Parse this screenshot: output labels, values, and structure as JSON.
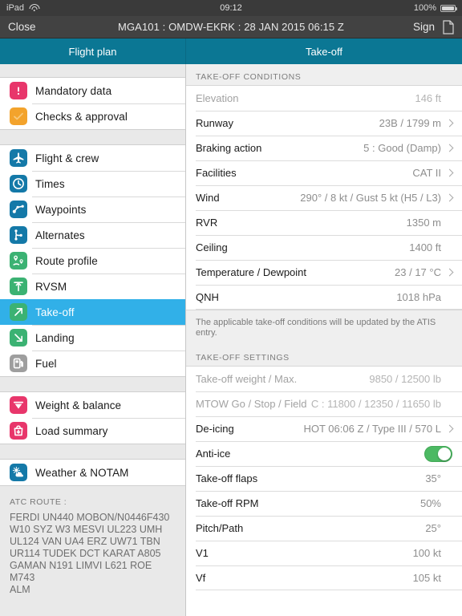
{
  "statusbar": {
    "device": "iPad",
    "wifi_icon": "wifi-icon",
    "time": "09:12",
    "battery_pct": "100%",
    "battery_icon": "battery-icon"
  },
  "navbar": {
    "close_label": "Close",
    "title": "MGA101 : OMDW-EKRK : 28 JAN 2015 06:15 Z",
    "sign_label": "Sign",
    "document_icon": "document-icon"
  },
  "tabs": {
    "left_label": "Flight plan",
    "right_label": "Take-off",
    "accent_color": "#0b7794"
  },
  "sidebar": {
    "groups": [
      {
        "items": [
          {
            "label": "Mandatory data",
            "icon": "exclamation-icon",
            "color": "#e8366b",
            "active": false
          },
          {
            "label": "Checks & approval",
            "icon": "checkmark-icon",
            "color": "#f3a32c",
            "active": false
          }
        ]
      },
      {
        "items": [
          {
            "label": "Flight & crew",
            "icon": "airplane-icon",
            "color": "#1479a8",
            "active": false
          },
          {
            "label": "Times",
            "icon": "clock-icon",
            "color": "#1479a8",
            "active": false
          },
          {
            "label": "Waypoints",
            "icon": "waypoints-icon",
            "color": "#1479a8",
            "active": false
          },
          {
            "label": "Alternates",
            "icon": "branch-icon",
            "color": "#1479a8",
            "active": false
          },
          {
            "label": "Route profile",
            "icon": "route-pins-icon",
            "color": "#3bb273",
            "active": false
          },
          {
            "label": "RVSM",
            "icon": "altitude-icon",
            "color": "#3bb273",
            "active": false
          },
          {
            "label": "Take-off",
            "icon": "arrow-up-right-icon",
            "color": "#3bb273",
            "active": true
          },
          {
            "label": "Landing",
            "icon": "arrow-down-right-icon",
            "color": "#3bb273",
            "active": false
          },
          {
            "label": "Fuel",
            "icon": "fuel-pump-icon",
            "color": "#9e9e9e",
            "active": false
          }
        ]
      },
      {
        "items": [
          {
            "label": "Weight & balance",
            "icon": "scale-icon",
            "color": "#e8366b",
            "active": false
          },
          {
            "label": "Load summary",
            "icon": "load-bag-icon",
            "color": "#e8366b",
            "active": false
          }
        ]
      },
      {
        "items": [
          {
            "label": "Weather & NOTAM",
            "icon": "weather-icon",
            "color": "#1479a8",
            "active": false
          }
        ]
      }
    ],
    "atc": {
      "heading": "ATC ROUTE :",
      "body": "FERDI UN440 MOBON/N0446F430\nW10 SYZ W3 MESVI UL223 UMH\nUL124 VAN UA4 ERZ UW71 TBN\nUR114 TUDEK DCT KARAT A805\nGAMAN N191 LIMVI L621 ROE M743\nALM"
    },
    "active_color": "#31b0e8"
  },
  "detail": {
    "conditions_header": "TAKE-OFF CONDITIONS",
    "conditions": [
      {
        "label": "Elevation",
        "value": "146 ft",
        "chevron": false,
        "dim": true
      },
      {
        "label": "Runway",
        "value": "23B / 1799 m",
        "chevron": true,
        "dim": false
      },
      {
        "label": "Braking action",
        "value": "5 : Good (Damp)",
        "chevron": true,
        "dim": false
      },
      {
        "label": "Facilities",
        "value": "CAT II",
        "chevron": true,
        "dim": false
      },
      {
        "label": "Wind",
        "value": "290° / 8 kt / Gust 5 kt (H5 / L3)",
        "chevron": true,
        "dim": false
      },
      {
        "label": "RVR",
        "value": "1350 m",
        "chevron": false,
        "dim": false
      },
      {
        "label": "Ceiling",
        "value": "1400 ft",
        "chevron": false,
        "dim": false
      },
      {
        "label": "Temperature / Dewpoint",
        "value": "23 / 17 °C",
        "chevron": true,
        "dim": false
      },
      {
        "label": "QNH",
        "value": "1018 hPa",
        "chevron": false,
        "dim": false
      }
    ],
    "note": "The applicable take-off conditions will be updated by the ATIS entry.",
    "settings_header": "TAKE-OFF SETTINGS",
    "settings": [
      {
        "label": "Take-off weight / Max.",
        "value": "9850 / 12500 lb",
        "chevron": false,
        "dim": true,
        "toggle": null
      },
      {
        "label": "MTOW Go / Stop / Field",
        "value": "C : 11800 / 12350 / 11650 lb",
        "chevron": false,
        "dim": true,
        "toggle": null
      },
      {
        "label": "De-icing",
        "value": "HOT 06:06 Z / Type III / 570 L",
        "chevron": true,
        "dim": false,
        "toggle": null
      },
      {
        "label": "Anti-ice",
        "value": "",
        "chevron": false,
        "dim": false,
        "toggle": "on"
      },
      {
        "label": "Take-off flaps",
        "value": "35°",
        "chevron": false,
        "dim": false,
        "toggle": null
      },
      {
        "label": "Take-off RPM",
        "value": "50%",
        "chevron": false,
        "dim": false,
        "toggle": null
      },
      {
        "label": "Pitch/Path",
        "value": "25°",
        "chevron": false,
        "dim": false,
        "toggle": null
      },
      {
        "label": "V1",
        "value": "100 kt",
        "chevron": false,
        "dim": false,
        "toggle": null
      },
      {
        "label": "Vf",
        "value": "105 kt",
        "chevron": false,
        "dim": false,
        "toggle": null
      }
    ],
    "toggle_on_color": "#4cb963"
  }
}
